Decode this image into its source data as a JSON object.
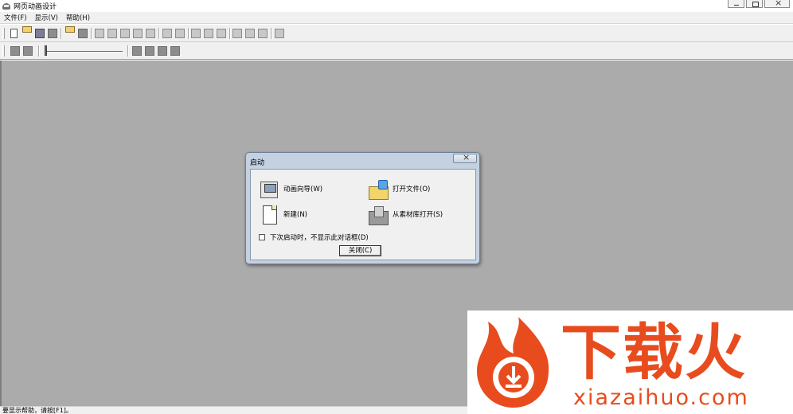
{
  "window": {
    "title": "网页动画设计"
  },
  "menu": {
    "items": [
      "文件(F)",
      "显示(V)",
      "帮助(H)"
    ]
  },
  "status": {
    "text": "要显示帮助，请按[F1]。"
  },
  "dialog": {
    "title": "启动",
    "options": [
      {
        "label": "动画向导(W)",
        "icon": "wizard-icon"
      },
      {
        "label": "打开文件(O)",
        "icon": "open-folder-icon"
      },
      {
        "label": "新建(N)",
        "icon": "new-document-icon"
      },
      {
        "label": "从素材库打开(S)",
        "icon": "library-icon"
      }
    ],
    "checkbox_label": "下次启动时，不显示此对话框(D)",
    "close_label": "关闭(C)"
  },
  "watermark": {
    "cn": "下载火",
    "en": "xiazaihuo.com"
  },
  "colors": {
    "workspace": "#ababab",
    "watermark": "#e84c1e"
  }
}
